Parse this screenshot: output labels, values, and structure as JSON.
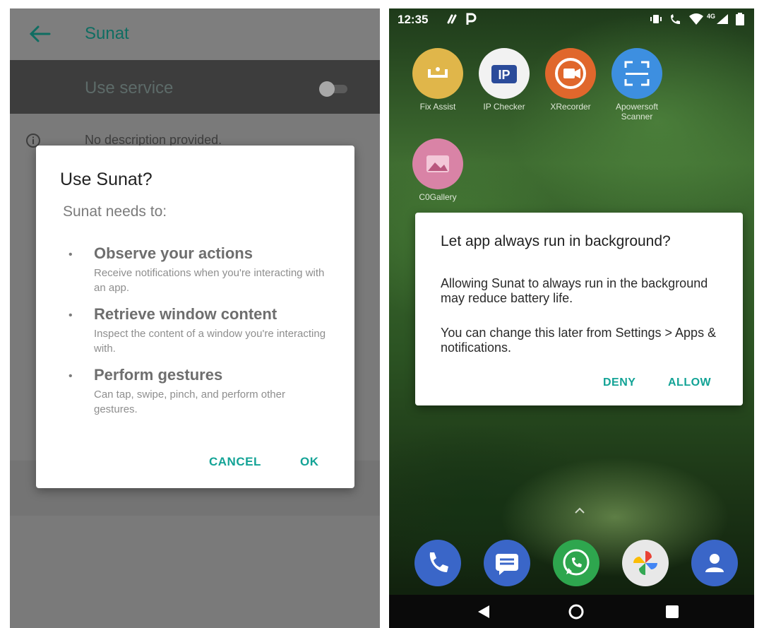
{
  "left": {
    "app_title": "Sunat",
    "service_label": "Use service",
    "description": "No description provided.",
    "dialog": {
      "title": "Use Sunat?",
      "subtitle": "Sunat needs to:",
      "permissions": [
        {
          "title": "Observe your actions",
          "desc": "Receive notifications when you're interacting with an app."
        },
        {
          "title": "Retrieve window content",
          "desc": "Inspect the content of a window you're interacting with."
        },
        {
          "title": "Perform gestures",
          "desc": "Can tap, swipe, pinch, and perform other gestures."
        }
      ],
      "cancel_label": "CANCEL",
      "ok_label": "OK"
    }
  },
  "right": {
    "status": {
      "time": "12:35",
      "network_label": "4G"
    },
    "apps": [
      {
        "name": "Fix Assist",
        "color": "#e0b64a"
      },
      {
        "name": "IP Checker",
        "color": "#f2f2f2"
      },
      {
        "name": "XRecorder",
        "color": "#e0672c"
      },
      {
        "name": "Apowersoft Scanner",
        "color": "#3d8fe0"
      },
      {
        "name": "C0Gallery",
        "color": "#d983a6"
      }
    ],
    "dialog": {
      "title": "Let app always run in background?",
      "body1": "Allowing Sunat to always run in the background may reduce battery life.",
      "body2": "You can change this later from Settings > Apps & notifications.",
      "deny_label": "DENY",
      "allow_label": "ALLOW"
    },
    "dock": [
      {
        "name": "phone-app",
        "color": "#3a66c8"
      },
      {
        "name": "messages-app",
        "color": "#3a66c8"
      },
      {
        "name": "whatsapp-app",
        "color": "#2ea64e"
      },
      {
        "name": "photos-app",
        "color": "#e8e8e8"
      },
      {
        "name": "contacts-app",
        "color": "#3a66c8"
      }
    ]
  }
}
